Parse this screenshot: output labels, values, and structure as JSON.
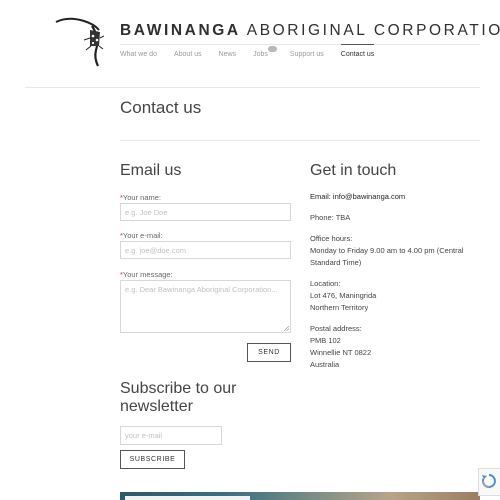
{
  "header": {
    "site_title_strong": "BAWINANGA",
    "site_title_rest": " ABORIGINAL CORPORATION",
    "nav": [
      {
        "label": "What we do",
        "active": false
      },
      {
        "label": "About us",
        "active": false
      },
      {
        "label": "News",
        "active": false
      },
      {
        "label": "Jobs",
        "active": false,
        "badge": true
      },
      {
        "label": "Support us",
        "active": false
      },
      {
        "label": "Contact us",
        "active": true
      }
    ]
  },
  "page": {
    "title": "Contact us"
  },
  "email_form": {
    "heading": "Email us",
    "required_mark": "*",
    "name_label": "Your name:",
    "name_placeholder": "e.g. Joe Doe",
    "email_label": "Your e-mail:",
    "email_placeholder": "e.g. joe@doe.com",
    "message_label": "Your message:",
    "message_placeholder": "e.g. Dear Bawinanga Aboriginal Corporation...",
    "send_label": "SEND"
  },
  "get_in_touch": {
    "heading": "Get in touch",
    "email_text": "Email: info@bawinanga.com",
    "phone_text": "Phone: TBA",
    "hours_title": "Office hours:",
    "hours_text": "Monday to Friday 9.00 am to 4.00 pm (Central Standard Time)",
    "location_title": "Location:",
    "location_line1": "Lot 476, Maningrida",
    "location_line2": "Northern Territory",
    "postal_title": "Postal address:",
    "postal_line1": "PMB 102",
    "postal_line2": "Winnellie NT 0822",
    "postal_line3": "Australia"
  },
  "newsletter": {
    "heading": "Subscribe to our newsletter",
    "email_placeholder": "your e-mail",
    "subscribe_label": "SUBSCRIBE"
  },
  "colors": {
    "required": "#c0392b",
    "text": "#444444",
    "border": "#d8d8d8"
  },
  "icons": [
    "logo-crocodile-icon",
    "resize-handle-icon",
    "recaptcha-icon"
  ]
}
